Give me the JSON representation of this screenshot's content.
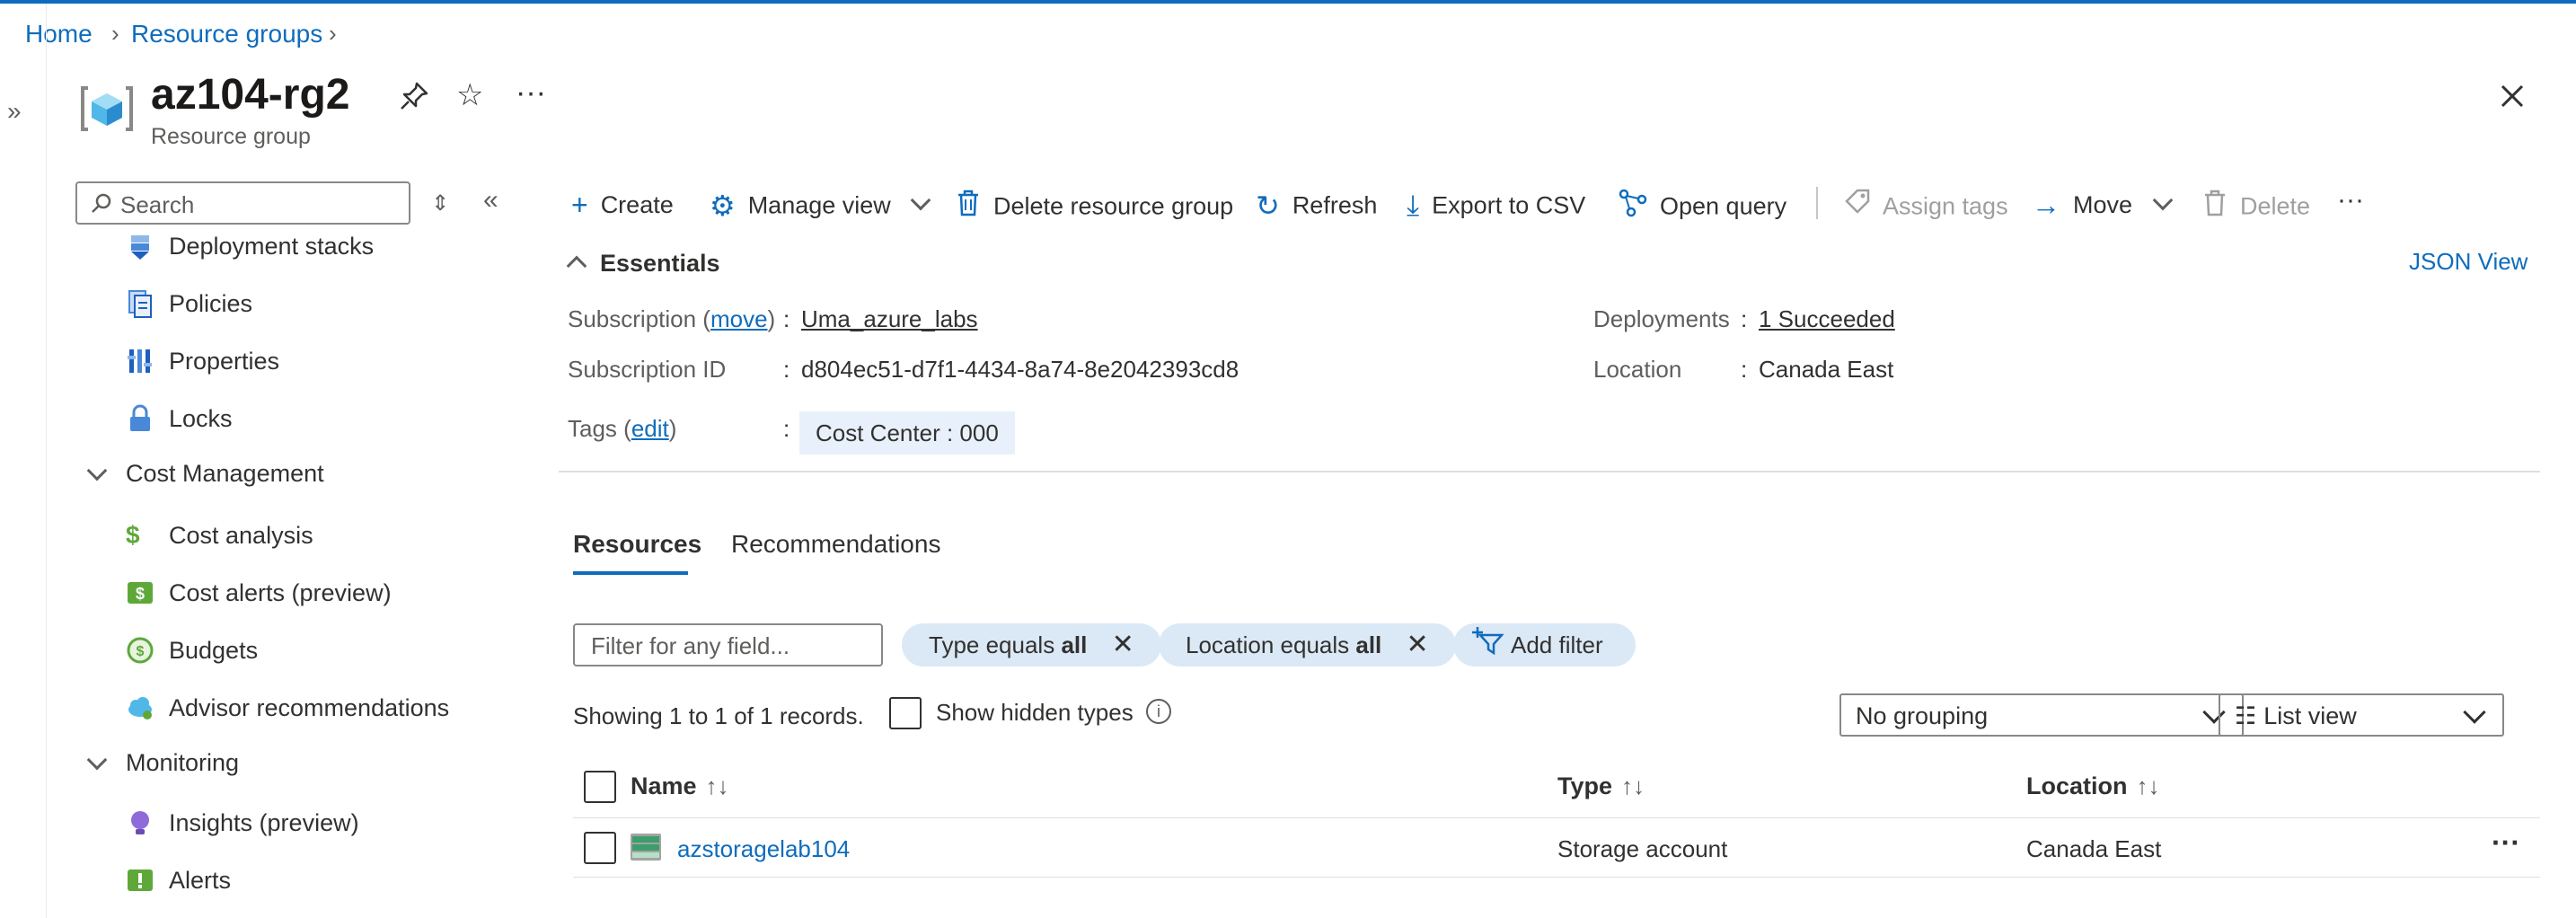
{
  "breadcrumb": {
    "items": [
      "Home",
      "Resource groups"
    ]
  },
  "header": {
    "title": "az104-rg2",
    "subtitle": "Resource group"
  },
  "sidebar": {
    "search_placeholder": "Search",
    "items": [
      {
        "label": "Deployment stacks",
        "icon": "deployment-stacks-icon"
      },
      {
        "label": "Policies",
        "icon": "policies-icon"
      },
      {
        "label": "Properties",
        "icon": "properties-icon"
      },
      {
        "label": "Locks",
        "icon": "lock-icon"
      }
    ],
    "groups": [
      {
        "label": "Cost Management",
        "items": [
          {
            "label": "Cost analysis",
            "icon": "cost-analysis-icon"
          },
          {
            "label": "Cost alerts (preview)",
            "icon": "cost-alerts-icon"
          },
          {
            "label": "Budgets",
            "icon": "budgets-icon"
          },
          {
            "label": "Advisor recommendations",
            "icon": "advisor-icon"
          }
        ]
      },
      {
        "label": "Monitoring",
        "items": [
          {
            "label": "Insights (preview)",
            "icon": "insights-icon"
          },
          {
            "label": "Alerts",
            "icon": "alerts-icon"
          }
        ]
      }
    ]
  },
  "toolbar": {
    "create": "Create",
    "manage_view": "Manage view",
    "delete_rg": "Delete resource group",
    "refresh": "Refresh",
    "export_csv": "Export to CSV",
    "open_query": "Open query",
    "assign_tags": "Assign tags",
    "move": "Move",
    "delete": "Delete"
  },
  "essentials": {
    "title": "Essentials",
    "json_view": "JSON View",
    "subscription_label": "Subscription",
    "subscription_move": "move",
    "subscription_value": "Uma_azure_labs",
    "subscription_id_label": "Subscription ID",
    "subscription_id_value": "d804ec51-d7f1-4434-8a74-8e2042393cd8",
    "tags_label": "Tags",
    "tags_edit": "edit",
    "tag_value": "Cost Center : 000",
    "deployments_label": "Deployments",
    "deployments_value": "1 Succeeded",
    "location_label": "Location",
    "location_value": "Canada East"
  },
  "tabs": [
    "Resources",
    "Recommendations"
  ],
  "filters": {
    "placeholder": "Filter for any field...",
    "type_prefix": "Type equals",
    "type_value": "all",
    "location_prefix": "Location equals",
    "location_value": "all",
    "add_filter": "Add filter"
  },
  "records": {
    "showing": "Showing 1 to 1 of 1 records.",
    "show_hidden": "Show hidden types",
    "grouping": "No grouping",
    "view": "List view"
  },
  "table": {
    "columns": [
      "Name",
      "Type",
      "Location"
    ],
    "rows": [
      {
        "name": "azstoragelab104",
        "type": "Storage account",
        "location": "Canada East"
      }
    ]
  },
  "colors": {
    "accent": "#0f6cbd",
    "chip_bg": "#dbe8f5"
  }
}
